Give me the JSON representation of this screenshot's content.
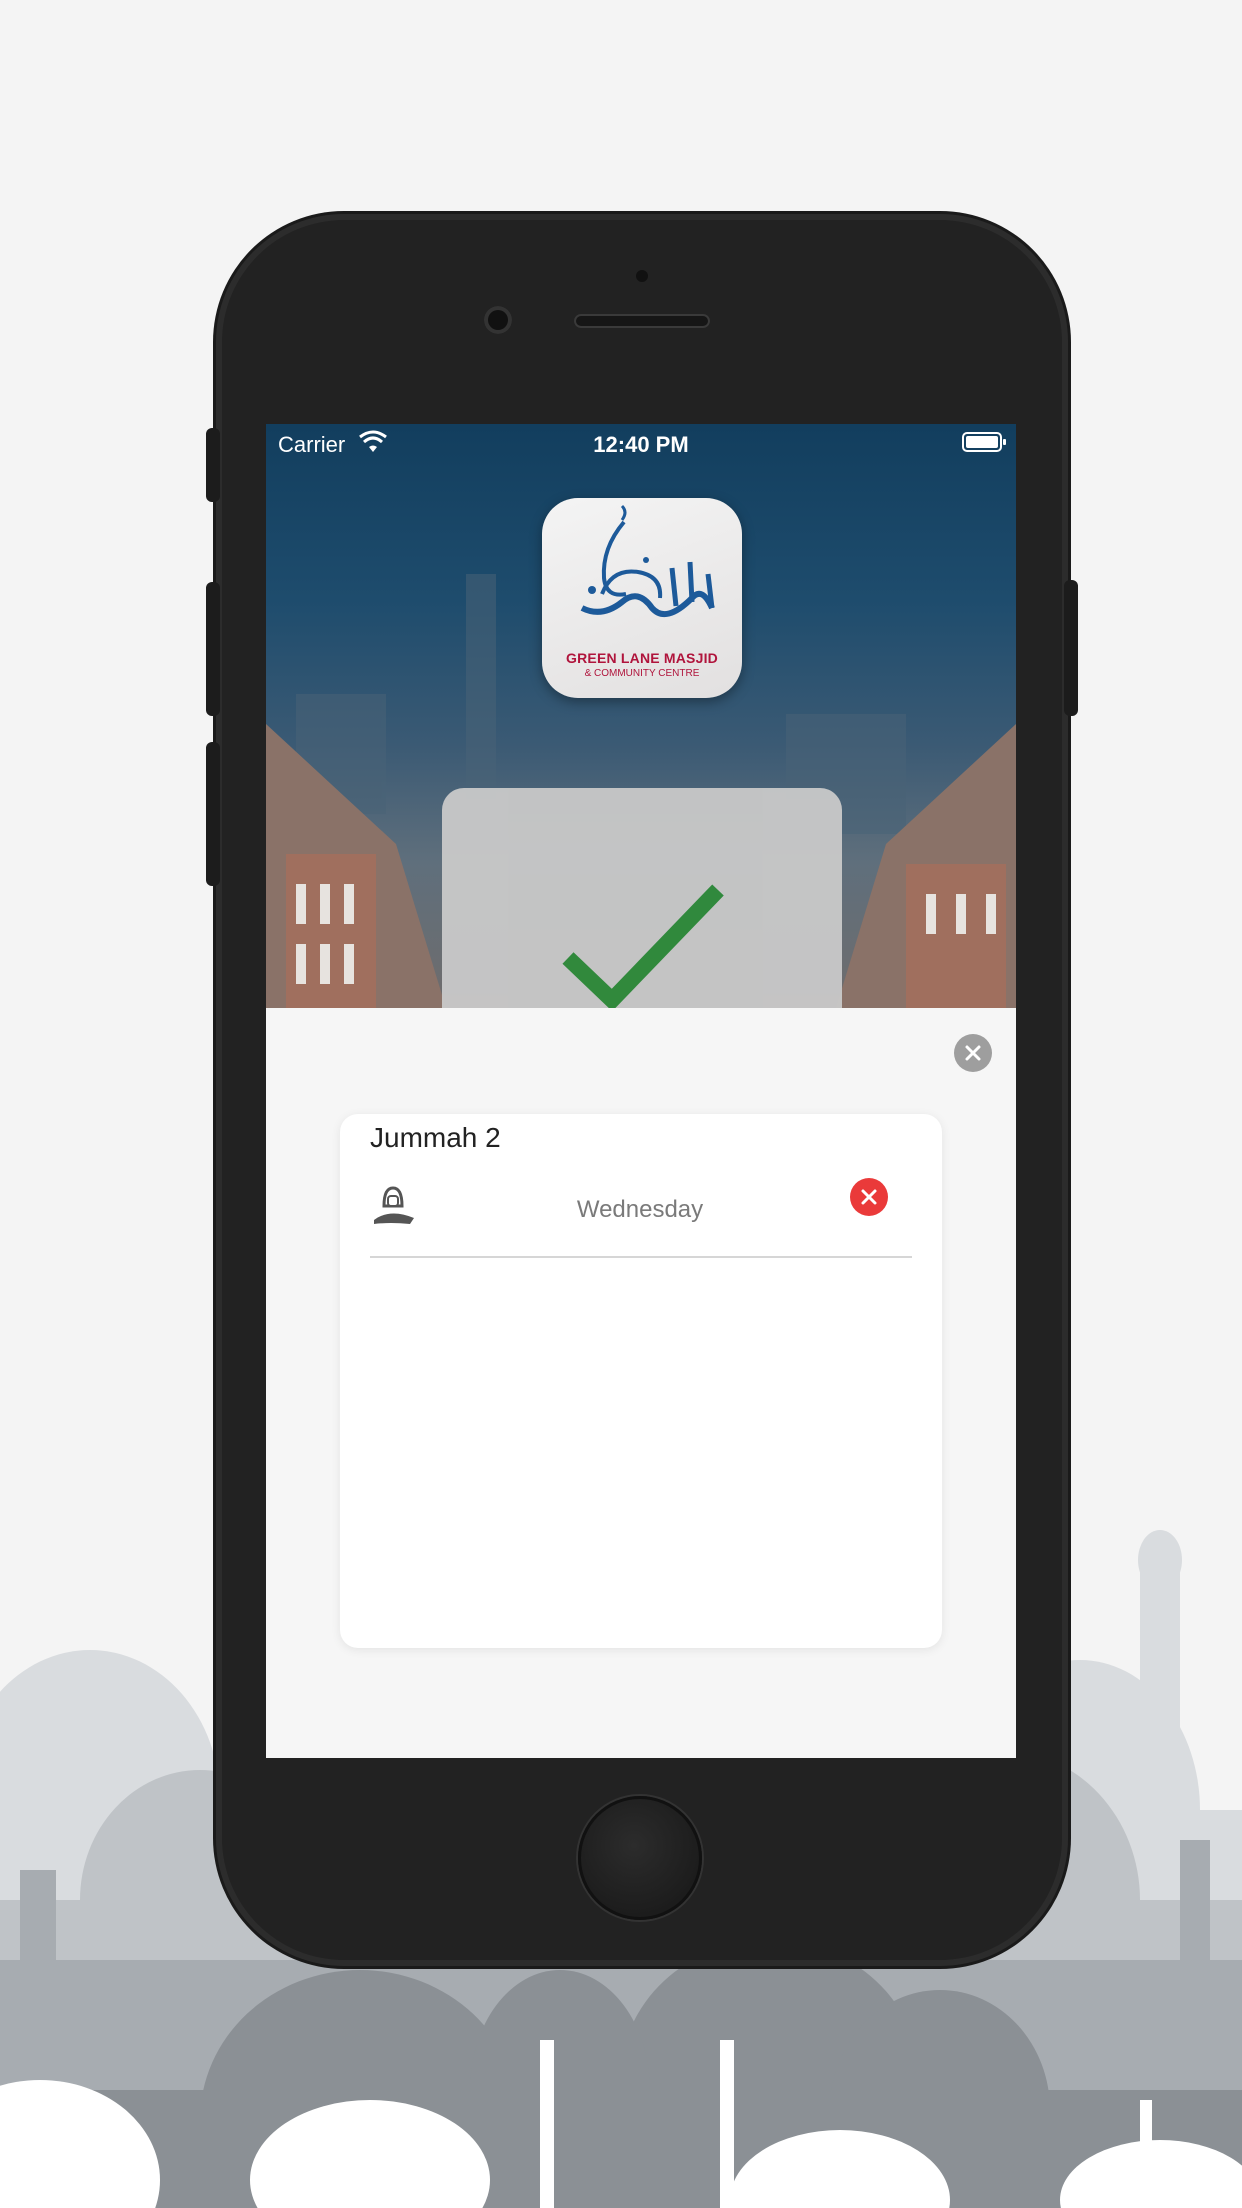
{
  "status_bar": {
    "carrier": "Carrier",
    "time": "12:40 PM"
  },
  "logo": {
    "name": "GREEN LANE MASJID",
    "subtitle": "& COMMUNITY CENTRE"
  },
  "card": {
    "title": "Jummah 2",
    "rows": [
      {
        "day": "Wednesday"
      }
    ]
  },
  "icons": {
    "close": "close-icon",
    "remove": "remove-icon",
    "person": "person-hijab-icon",
    "check": "checkmark-icon"
  },
  "colors": {
    "check_green": "#2e8b3a",
    "remove_red": "#ea3a3a",
    "hero_blue": "#123e5e"
  }
}
